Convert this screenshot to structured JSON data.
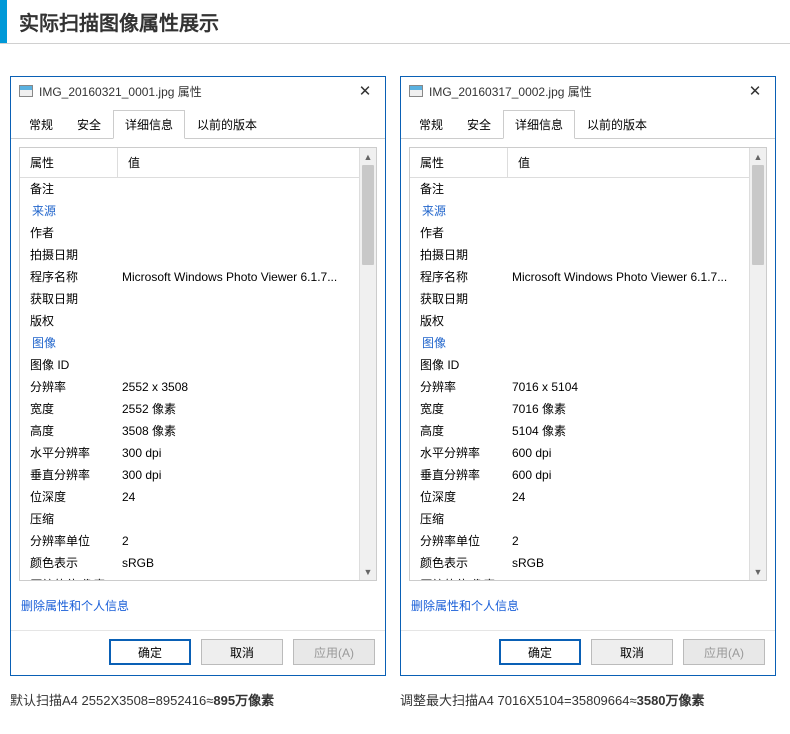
{
  "page_title": "实际扫描图像属性展示",
  "tabs": [
    "常规",
    "安全",
    "详细信息",
    "以前的版本"
  ],
  "active_tab_index": 2,
  "columns": {
    "property": "属性",
    "value": "值"
  },
  "sections": {
    "source": "来源",
    "image": "图像"
  },
  "labels": {
    "remark": "备注",
    "author": "作者",
    "shoot_date": "拍摄日期",
    "program": "程序名称",
    "acquire_date": "获取日期",
    "copyright": "版权",
    "image_id": "图像 ID",
    "resolution": "分辨率",
    "width": "宽度",
    "height": "高度",
    "hdpi": "水平分辨率",
    "vdpi": "垂直分辨率",
    "bitdepth": "位深度",
    "compression": "压缩",
    "res_unit": "分辨率单位",
    "color_rep": "颜色表示",
    "cbpp": "压缩的位/像素"
  },
  "link_text": "删除属性和个人信息",
  "buttons": {
    "ok": "确定",
    "cancel": "取消",
    "apply": "应用(A)"
  },
  "dialogs": [
    {
      "title": "IMG_20160321_0001.jpg 属性",
      "program": "Microsoft Windows Photo Viewer 6.1.7...",
      "resolution": "2552 x 3508",
      "width": "2552 像素",
      "height": "3508 像素",
      "hdpi": "300 dpi",
      "vdpi": "300 dpi",
      "bitdepth": "24",
      "res_unit": "2",
      "color_rep": "sRGB",
      "caption_prefix": "默认扫描A4",
      "caption_calc": "2552X3508=8952416≈",
      "caption_bold": "895万像素"
    },
    {
      "title": "IMG_20160317_0002.jpg 属性",
      "program": "Microsoft Windows Photo Viewer 6.1.7...",
      "resolution": "7016 x 5104",
      "width": "7016 像素",
      "height": "5104 像素",
      "hdpi": "600 dpi",
      "vdpi": "600 dpi",
      "bitdepth": "24",
      "res_unit": "2",
      "color_rep": "sRGB",
      "caption_prefix": "调整最大扫描A4",
      "caption_calc": "7016X5104=35809664≈",
      "caption_bold": "3580万像素"
    }
  ]
}
